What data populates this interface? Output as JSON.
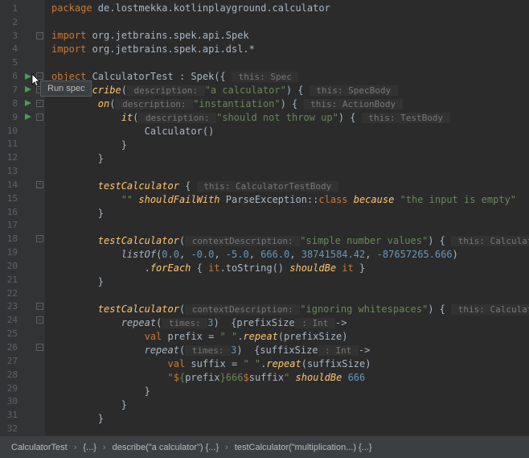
{
  "tooltip": "Run spec",
  "lines": [
    {
      "n": 1
    },
    {
      "n": 2
    },
    {
      "n": 3
    },
    {
      "n": 4
    },
    {
      "n": 5
    },
    {
      "n": 6
    },
    {
      "n": 7
    },
    {
      "n": 8
    },
    {
      "n": 9
    },
    {
      "n": 10
    },
    {
      "n": 11
    },
    {
      "n": 12
    },
    {
      "n": 13
    },
    {
      "n": 14
    },
    {
      "n": 15
    },
    {
      "n": 16
    },
    {
      "n": 17
    },
    {
      "n": 18
    },
    {
      "n": 19
    },
    {
      "n": 20
    },
    {
      "n": 21
    },
    {
      "n": 22
    },
    {
      "n": 23
    },
    {
      "n": 24
    },
    {
      "n": 25
    },
    {
      "n": 26
    },
    {
      "n": 27
    },
    {
      "n": 28
    },
    {
      "n": 29
    },
    {
      "n": 30
    },
    {
      "n": 31
    },
    {
      "n": 32
    }
  ],
  "code": {
    "l1_kw": "package",
    "l1_pkg": " de.lostmekka.kotlinplayground.calculator",
    "l3_kw": "import",
    "l3_pkg": " org.jetbrains.spek.api.Spek",
    "l4_kw": "import",
    "l4_pkg": " org.jetbrains.spek.api.dsl.*",
    "l6_kw": "object ",
    "l6_name": "CalculatorTest : Spek(",
    "l6_brace": "{",
    "l6_hint": " this: Spec ",
    "l7_fn": "describe",
    "l7_p": "(",
    "l7_hint": " description: ",
    "l7_str": "\"a calculator\"",
    "l7_r": ") {",
    "l7_hint2": " this: SpecBody ",
    "l8_fn": "on",
    "l8_p": "(",
    "l8_hint": " description: ",
    "l8_str": "\"instantiation\"",
    "l8_r": ") {",
    "l8_hint2": " this: ActionBody ",
    "l9_fn": "it",
    "l9_p": "(",
    "l9_hint": " description: ",
    "l9_str": "\"should not throw up\"",
    "l9_r": ") {",
    "l9_hint2": " this: TestBody ",
    "l10": "Calculator()",
    "l11": "}",
    "l12": "}",
    "l14_fn": "testCalculator",
    "l14_b": " {",
    "l14_hint": " this: CalculatorTestBody ",
    "l15_str": "\"\"",
    "l15_sp": " ",
    "l15_fn": "shouldFailWith",
    "l15_mid": " ParseException::",
    "l15_kw": "class ",
    "l15_fn2": "because ",
    "l15_str2": "\"the input is empty\"",
    "l16": "}",
    "l18_fn": "testCalculator",
    "l18_p": "(",
    "l18_hint": " contextDescription: ",
    "l18_str": "\"simple number values\"",
    "l18_r": ") {",
    "l18_hint2": " this: CalculatorTestBody ",
    "l19_fn": "listOf",
    "l19_p": "(",
    "l19_n1": "0.0",
    "l19_c": ", ",
    "l19_n2": "-0.0",
    "l19_n3": "-5.0",
    "l19_n4": "666.0",
    "l19_n5": "38741584.42",
    "l19_n6": "-87657265.666",
    "l19_r": ")",
    "l20_p": ".",
    "l20_fn": "forEach",
    "l20_b": " { ",
    "l20_it": "it",
    "l20_m": ".toString() ",
    "l20_fn2": "shouldBe",
    "l20_sp": " ",
    "l20_it2": "it",
    "l20_e": " }",
    "l21": "}",
    "l23_fn": "testCalculator",
    "l23_p": "(",
    "l23_hint": " contextDescription: ",
    "l23_str": "\"ignoring whitespaces\"",
    "l23_r": ") {",
    "l23_hint2": " this: CalculatorTestBody ",
    "l24_fn": "repeat",
    "l24_p": "(",
    "l24_hint": " times: ",
    "l24_n": "3",
    "l24_r": ")  {prefixSize",
    "l24_hint2": " : Int ",
    "l24_ar": "->",
    "l25_kw": "val ",
    "l25_v": "prefix = ",
    "l25_str": "\" \"",
    "l25_p": ".",
    "l25_fn": "repeat",
    "l25_r": "(prefixSize)",
    "l26_fn": "repeat",
    "l26_p": "(",
    "l26_hint": " times: ",
    "l26_n": "3",
    "l26_r": ")  {suffixSize",
    "l26_hint2": " : Int ",
    "l26_ar": "->",
    "l27_kw": "val ",
    "l27_v": "suffix = ",
    "l27_str": "\" \"",
    "l27_p": ".",
    "l27_fn": "repeat",
    "l27_r": "(suffixSize)",
    "l28_s1": "\"",
    "l28_s2": "$",
    "l28_s3": "{",
    "l28_v1": "prefix",
    "l28_s4": "}",
    "l28_s5": "666",
    "l28_s6": "$",
    "l28_v2": "suffix",
    "l28_s7": "\"",
    "l28_sp": " ",
    "l28_fn": "shouldBe",
    "l28_sp2": " ",
    "l28_n": "666",
    "l29": "}",
    "l30": "}",
    "l31": "}"
  },
  "breadcrumbs": {
    "b1": "CalculatorTest",
    "b2": "{...}",
    "b3": "describe(\"a calculator\") {...}",
    "b4": "testCalculator(\"multiplication...) {...}"
  }
}
